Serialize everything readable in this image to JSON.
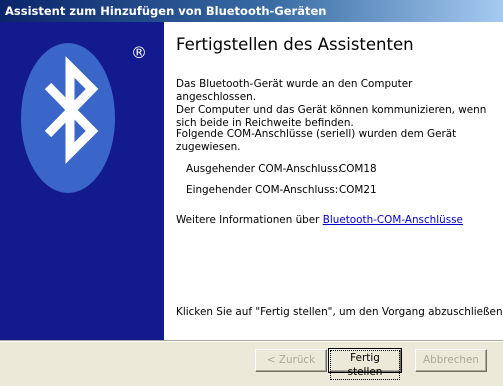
{
  "window": {
    "title": "Assistent zum Hinzufügen von Bluetooth-Geräten"
  },
  "colors": {
    "left_panel": "#131a8e",
    "logo_oval": "#3a66c9",
    "link": "#0000cc"
  },
  "logo": {
    "icon": "bluetooth-logo",
    "registered_mark": "®"
  },
  "main": {
    "heading": "Fertigstellen des Assistenten",
    "para1_lines": [
      "Das Bluetooth-Gerät wurde an den Computer angeschlossen.",
      "Der Computer und das Gerät können kommunizieren, wenn",
      "sich beide in Reichweite befinden."
    ],
    "para2_lines": [
      "Folgende COM-Anschlüsse (seriell) wurden dem Gerät",
      "zugewiesen."
    ],
    "outgoing_label": "Ausgehender COM-Anschluss:",
    "outgoing_value": "COM18",
    "incoming_label": "Eingehender COM-Anschluss:",
    "incoming_value": "COM21",
    "info_prefix": "Weitere Informationen über ",
    "info_link": "Bluetooth-COM-Anschlüsse",
    "finish_text": "Klicken Sie auf \"Fertig stellen\", um den Vorgang abzuschließen."
  },
  "buttons": {
    "back": "< Zurück",
    "finish": "Fertig stellen",
    "cancel": "Abbrechen"
  }
}
